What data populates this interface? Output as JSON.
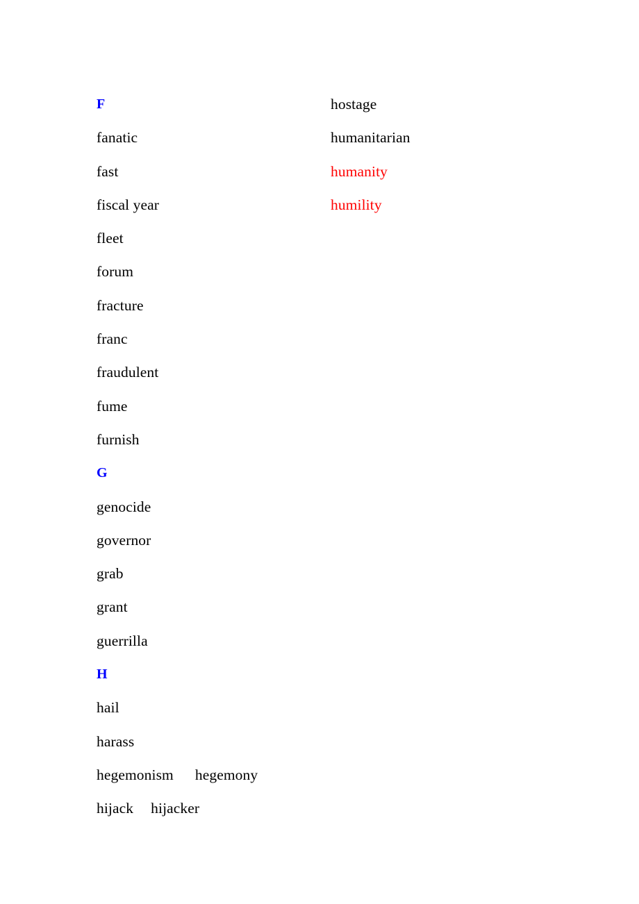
{
  "document": {
    "kind": "vocabulary-word-list",
    "page_background": "#ffffff",
    "colors": {
      "body_text": "#000000",
      "section_heading": "#0000FF",
      "highlight": "#FF0000"
    }
  },
  "columns": {
    "left": [
      {
        "text": "F",
        "type": "heading"
      },
      {
        "text": "fanatic",
        "type": "word"
      },
      {
        "text": "fast",
        "type": "word"
      },
      {
        "text": "fiscal year",
        "type": "word"
      },
      {
        "text": "fleet",
        "type": "word"
      },
      {
        "text": "forum",
        "type": "word"
      },
      {
        "text": "fracture",
        "type": "word"
      },
      {
        "text": "franc",
        "type": "word"
      },
      {
        "text": "fraudulent",
        "type": "word"
      },
      {
        "text": "fume",
        "type": "word"
      },
      {
        "text": "furnish",
        "type": "word"
      },
      {
        "text": "G",
        "type": "heading"
      },
      {
        "text": "genocide",
        "type": "word"
      },
      {
        "text": "governor",
        "type": "word"
      },
      {
        "text": "grab",
        "type": "word"
      },
      {
        "text": "grant",
        "type": "word"
      },
      {
        "text": "guerrilla",
        "type": "word"
      },
      {
        "text": "H",
        "type": "heading"
      },
      {
        "text": "hail",
        "type": "word"
      },
      {
        "text": "harass",
        "type": "word"
      },
      {
        "text": "hegemonism",
        "type": "word",
        "second": "hegemony"
      },
      {
        "text": "hijack",
        "type": "word",
        "second": "hijacker"
      }
    ],
    "right": [
      {
        "text": "hostage",
        "type": "word"
      },
      {
        "text": "humanitarian",
        "type": "word"
      },
      {
        "text": "humanity",
        "type": "highlight"
      },
      {
        "text": "humility",
        "type": "highlight"
      }
    ]
  }
}
